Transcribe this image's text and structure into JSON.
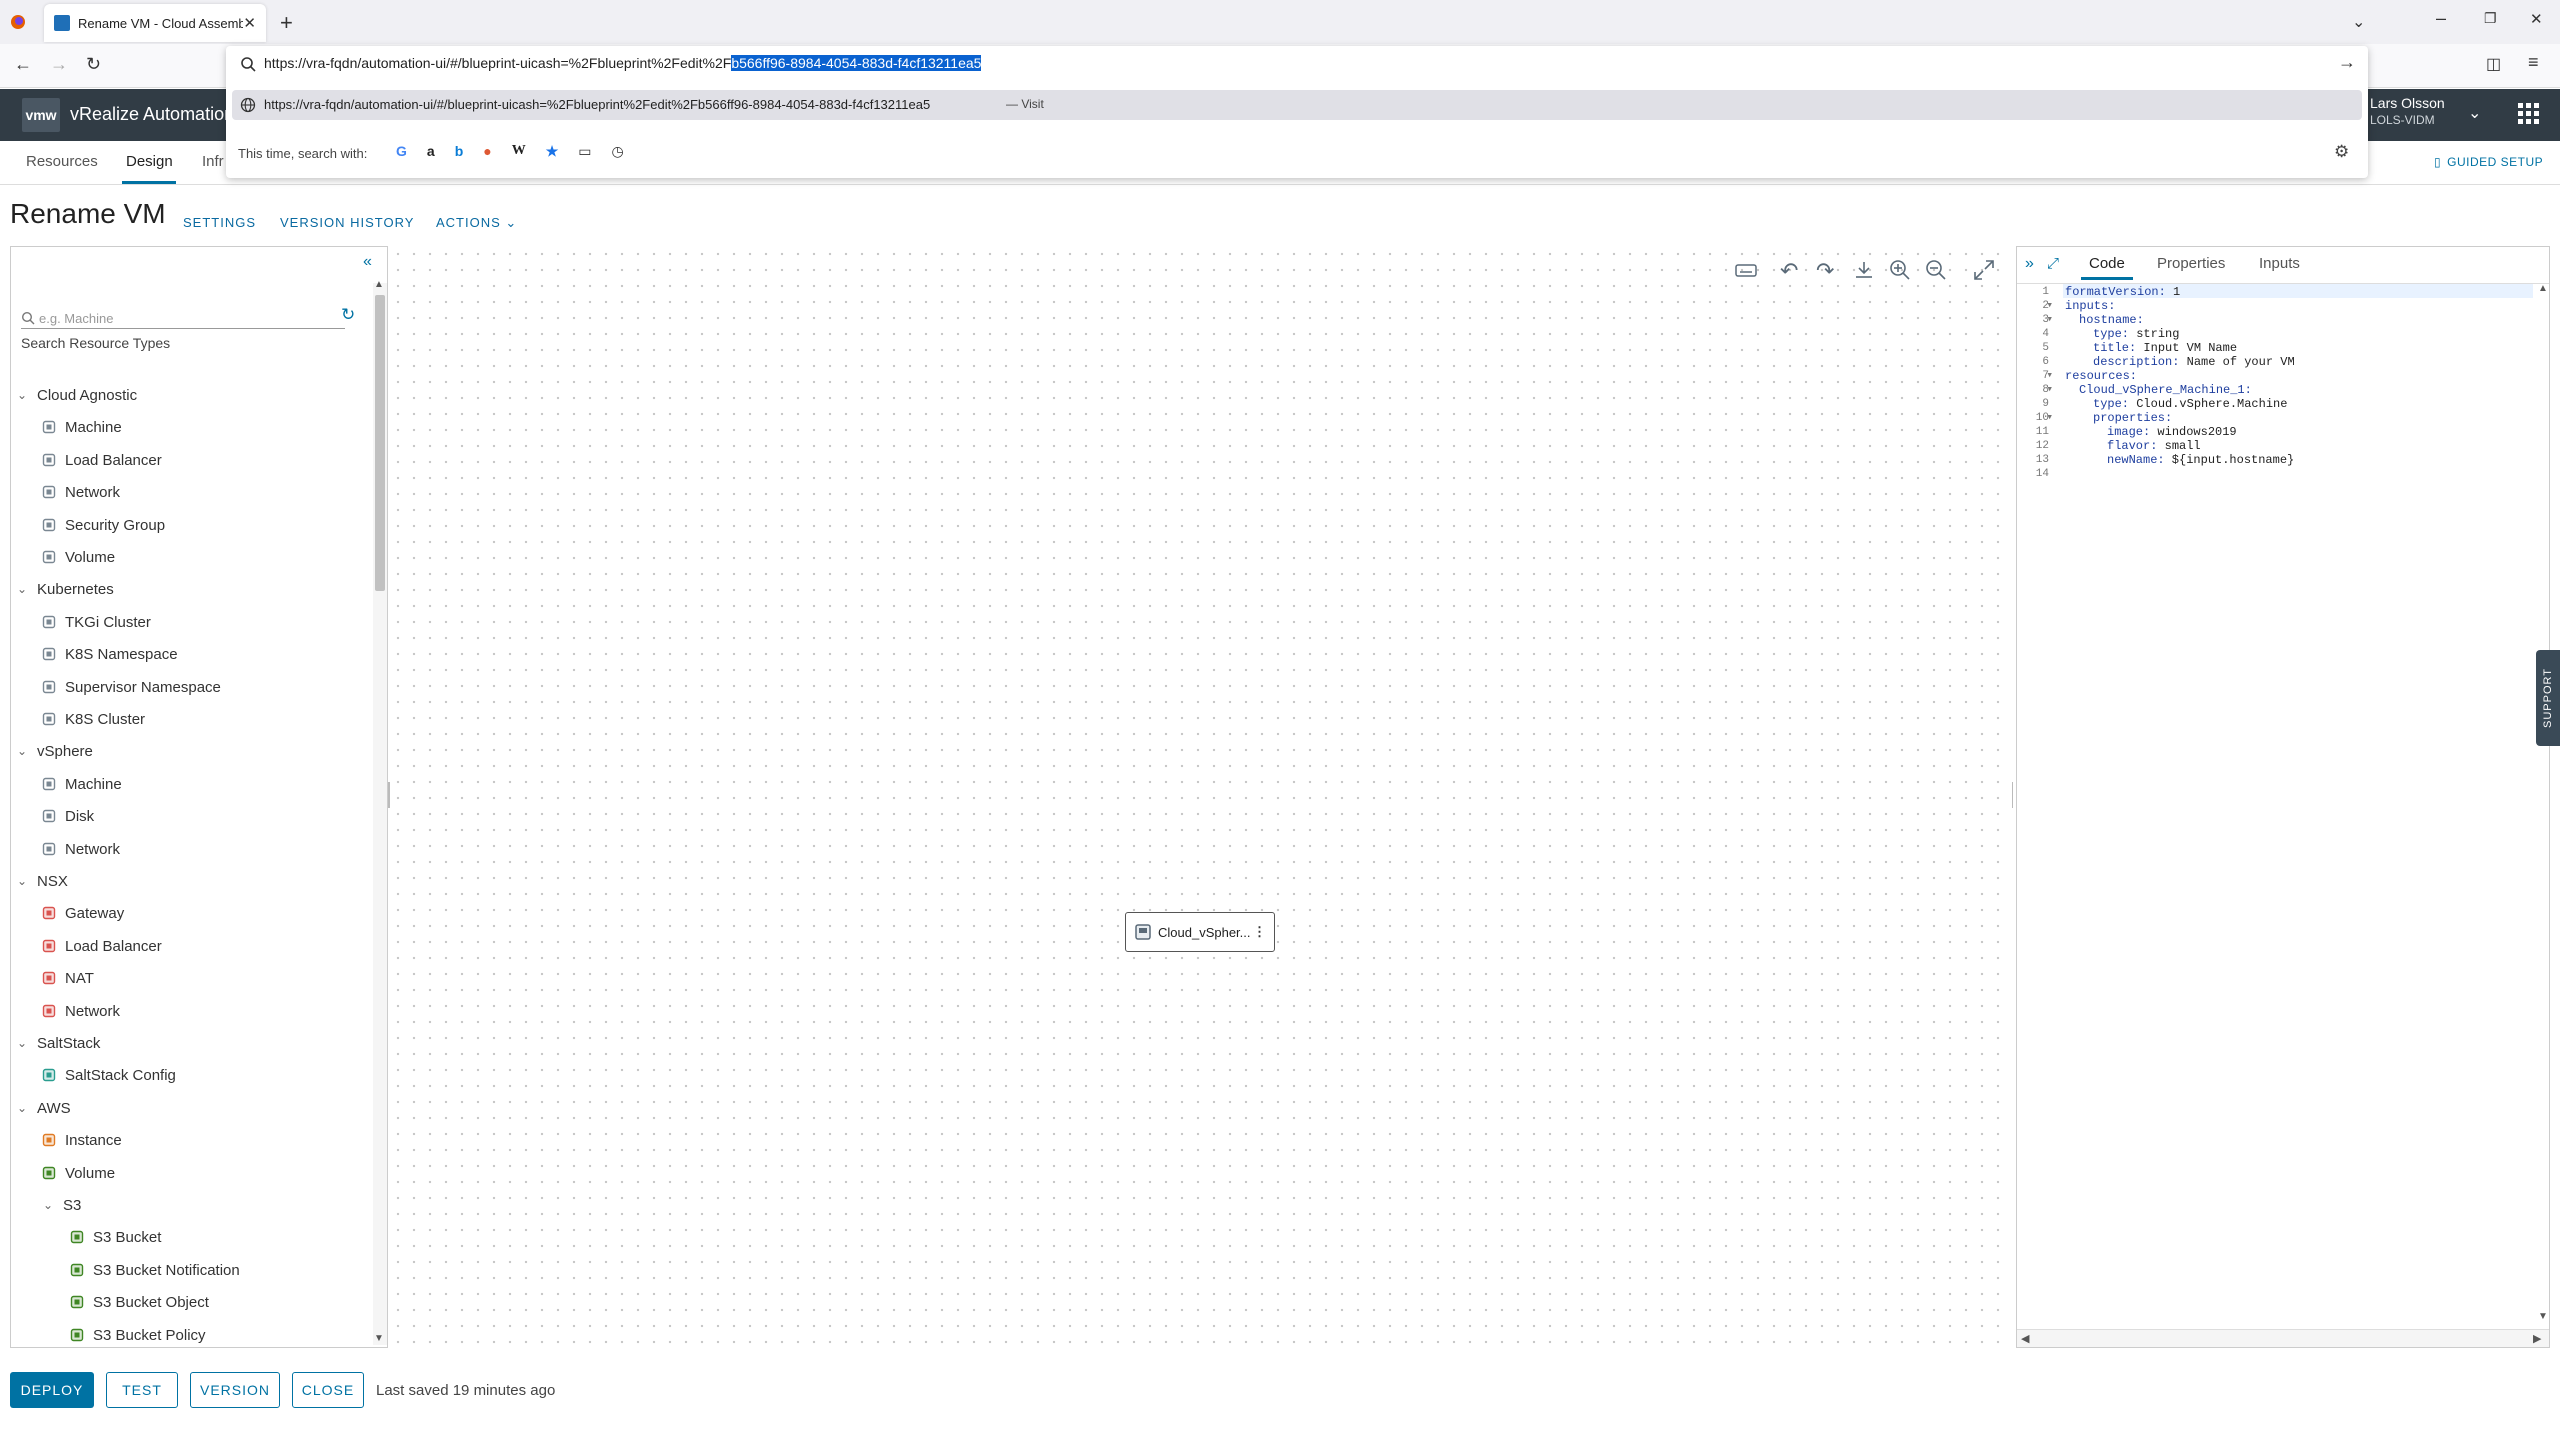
{
  "browser": {
    "tab_title": "Rename VM - Cloud Assembly",
    "url_plain": "https://vra-fqdn/automation-ui/#/blueprint-uicash=%2Fblueprint%2Fedit%2F",
    "url_selected": "b566ff96-8984-4054-883d-f4cf13211ea5",
    "suggestion_url": "https://vra-fqdn/automation-ui/#/blueprint-uicash=%2Fblueprint%2Fedit%2Fb566ff96-8984-4054-883d-f4cf13211ea5",
    "suggestion_action": "— Visit",
    "search_with_label": "This time, search with:",
    "engines": [
      "Google",
      "Amazon",
      "Bing",
      "DuckDuckGo",
      "Wikipedia",
      "Bookmarks",
      "Tabs",
      "History"
    ]
  },
  "app": {
    "logo": "vmw",
    "product": "vRealize Automation",
    "user_name": "Lars Olsson",
    "user_org": "LOLS-VIDM",
    "guided_setup": "GUIDED SETUP",
    "support": "SUPPORT",
    "nav": [
      "Resources",
      "Design",
      "Infr"
    ]
  },
  "page": {
    "title": "Rename VM",
    "settings": "SETTINGS",
    "version_history": "VERSION HISTORY",
    "actions": "ACTIONS"
  },
  "search": {
    "placeholder": "e.g. Machine",
    "label": "Search Resource Types"
  },
  "tree": [
    {
      "label": "Cloud Agnostic",
      "type": "category"
    },
    {
      "label": "Machine",
      "type": "item",
      "icon": "machine-icon"
    },
    {
      "label": "Load Balancer",
      "type": "item",
      "icon": "load-balancer-icon"
    },
    {
      "label": "Network",
      "type": "item",
      "icon": "network-icon"
    },
    {
      "label": "Security Group",
      "type": "item",
      "icon": "security-group-icon"
    },
    {
      "label": "Volume",
      "type": "item",
      "icon": "volume-icon"
    },
    {
      "label": "Kubernetes",
      "type": "category"
    },
    {
      "label": "TKGi Cluster",
      "type": "item",
      "icon": "cluster-icon"
    },
    {
      "label": "K8S Namespace",
      "type": "item",
      "icon": "namespace-icon"
    },
    {
      "label": "Supervisor Namespace",
      "type": "item",
      "icon": "namespace-icon"
    },
    {
      "label": "K8S Cluster",
      "type": "item",
      "icon": "cluster-icon"
    },
    {
      "label": "vSphere",
      "type": "category"
    },
    {
      "label": "Machine",
      "type": "item",
      "icon": "vsphere-machine-icon"
    },
    {
      "label": "Disk",
      "type": "item",
      "icon": "disk-icon"
    },
    {
      "label": "Network",
      "type": "item",
      "icon": "network-icon"
    },
    {
      "label": "NSX",
      "type": "category"
    },
    {
      "label": "Gateway",
      "type": "item",
      "icon": "nsx-gateway-icon"
    },
    {
      "label": "Load Balancer",
      "type": "item",
      "icon": "nsx-load-balancer-icon"
    },
    {
      "label": "NAT",
      "type": "item",
      "icon": "nsx-nat-icon"
    },
    {
      "label": "Network",
      "type": "item",
      "icon": "nsx-network-icon"
    },
    {
      "label": "SaltStack",
      "type": "category"
    },
    {
      "label": "SaltStack Config",
      "type": "item",
      "icon": "saltstack-icon"
    },
    {
      "label": "AWS",
      "type": "category"
    },
    {
      "label": "Instance",
      "type": "item",
      "icon": "aws-instance-icon"
    },
    {
      "label": "Volume",
      "type": "item",
      "icon": "aws-volume-icon"
    },
    {
      "label": "S3",
      "type": "subcategory"
    },
    {
      "label": "S3 Bucket",
      "type": "subitem",
      "icon": "s3-icon"
    },
    {
      "label": "S3 Bucket Notification",
      "type": "subitem",
      "icon": "s3-icon"
    },
    {
      "label": "S3 Bucket Object",
      "type": "subitem",
      "icon": "s3-icon"
    },
    {
      "label": "S3 Bucket Policy",
      "type": "subitem",
      "icon": "s3-icon"
    }
  ],
  "canvas": {
    "node_label": "Cloud_vSpher..."
  },
  "editor": {
    "tabs": [
      "Code",
      "Properties",
      "Inputs"
    ],
    "active_tab": "Code",
    "lines": [
      {
        "n": "1",
        "fold": "",
        "indent": 0,
        "key": "formatVersion:",
        "val": " 1"
      },
      {
        "n": "2",
        "fold": "▾",
        "indent": 0,
        "key": "inputs:",
        "val": ""
      },
      {
        "n": "3",
        "fold": "▾",
        "indent": 1,
        "key": "hostname:",
        "val": ""
      },
      {
        "n": "4",
        "fold": "",
        "indent": 2,
        "key": "type:",
        "val": " string"
      },
      {
        "n": "5",
        "fold": "",
        "indent": 2,
        "key": "title:",
        "val": " Input VM Name"
      },
      {
        "n": "6",
        "fold": "",
        "indent": 2,
        "key": "description:",
        "val": " Name of your VM"
      },
      {
        "n": "7",
        "fold": "▾",
        "indent": 0,
        "key": "resources:",
        "val": ""
      },
      {
        "n": "8",
        "fold": "▾",
        "indent": 1,
        "key": "Cloud_vSphere_Machine_1:",
        "val": ""
      },
      {
        "n": "9",
        "fold": "",
        "indent": 2,
        "key": "type:",
        "val": " Cloud.vSphere.Machine"
      },
      {
        "n": "10",
        "fold": "▾",
        "indent": 2,
        "key": "properties:",
        "val": ""
      },
      {
        "n": "11",
        "fold": "",
        "indent": 3,
        "key": "image:",
        "val": " windows2019"
      },
      {
        "n": "12",
        "fold": "",
        "indent": 3,
        "key": "flavor:",
        "val": " small"
      },
      {
        "n": "13",
        "fold": "",
        "indent": 3,
        "key": "newName:",
        "val": " ${input.hostname}"
      },
      {
        "n": "14",
        "fold": "",
        "indent": 0,
        "key": "",
        "val": ""
      }
    ]
  },
  "footer": {
    "deploy": "DEPLOY",
    "test": "TEST",
    "version": "VERSION",
    "close": "CLOSE",
    "status": "Last saved 19 minutes ago"
  },
  "colors": {
    "header_bg": "#313c45",
    "accent": "#0072a3",
    "selection": "#0a62d0"
  }
}
